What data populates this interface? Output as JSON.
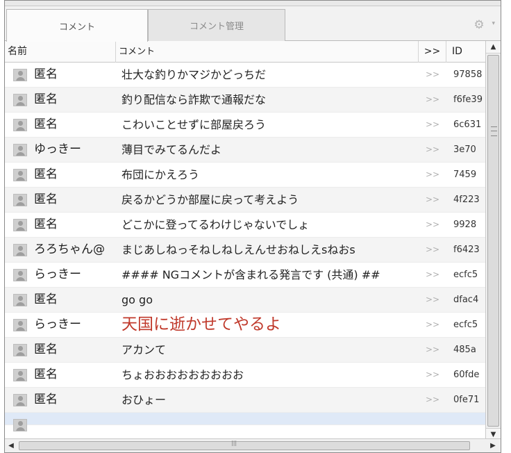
{
  "tabs": [
    {
      "label": "コメント",
      "active": true
    },
    {
      "label": "コメント管理",
      "active": false
    }
  ],
  "settings_icon": "gear-icon",
  "columns": {
    "name": "名前",
    "comment": "コメント",
    "jump": ">>",
    "id": "ID"
  },
  "rows": [
    {
      "name": "匿名",
      "comment": "壮大な釣りかマジかどっちだ",
      "jump": ">>",
      "id": "97858"
    },
    {
      "name": "匿名",
      "comment": "釣り配信なら詐欺で通報だな",
      "jump": ">>",
      "id": "f6fe39"
    },
    {
      "name": "匿名",
      "comment": "こわいことせずに部屋戻ろう",
      "jump": ">>",
      "id": "6c631"
    },
    {
      "name": "ゆっきー",
      "comment": "薄目でみてるんだよ",
      "jump": ">>",
      "id": "3e70"
    },
    {
      "name": "匿名",
      "comment": "布団にかえろう",
      "jump": ">>",
      "id": "7459"
    },
    {
      "name": "匿名",
      "comment": "戻るかどうか部屋に戻って考えよう",
      "jump": ">>",
      "id": "4f223"
    },
    {
      "name": "匿名",
      "comment": "どこかに登ってるわけじゃないでしょ",
      "jump": ">>",
      "id": "9928"
    },
    {
      "name": "ろろちゃん@",
      "comment": "まじあしねっそねしねしえんせおねしえsねおs",
      "jump": ">>",
      "id": "f6423"
    },
    {
      "name": "らっきー",
      "comment": "#### NGコメントが含まれる発言です (共通) ##",
      "jump": ">>",
      "id": "ecfc5"
    },
    {
      "name": "匿名",
      "comment": "go go",
      "jump": ">>",
      "id": "dfac4"
    },
    {
      "name": "らっきー",
      "comment": "天国に逝かせてやるよ",
      "jump": ">>",
      "id": "ecfc5"
    },
    {
      "name": "匿名",
      "comment": "アカンて",
      "jump": ">>",
      "id": "485a"
    },
    {
      "name": "匿名",
      "comment": "ちょおおおおおおおおお",
      "jump": ">>",
      "id": "60fde"
    },
    {
      "name": "匿名",
      "comment": "おひょー",
      "jump": ">>",
      "id": "0fe71"
    }
  ],
  "colors": {
    "highlight_comment": "#c0392b",
    "jump_text": "#b0b0b0",
    "selected_row": "#dfe9f7"
  }
}
